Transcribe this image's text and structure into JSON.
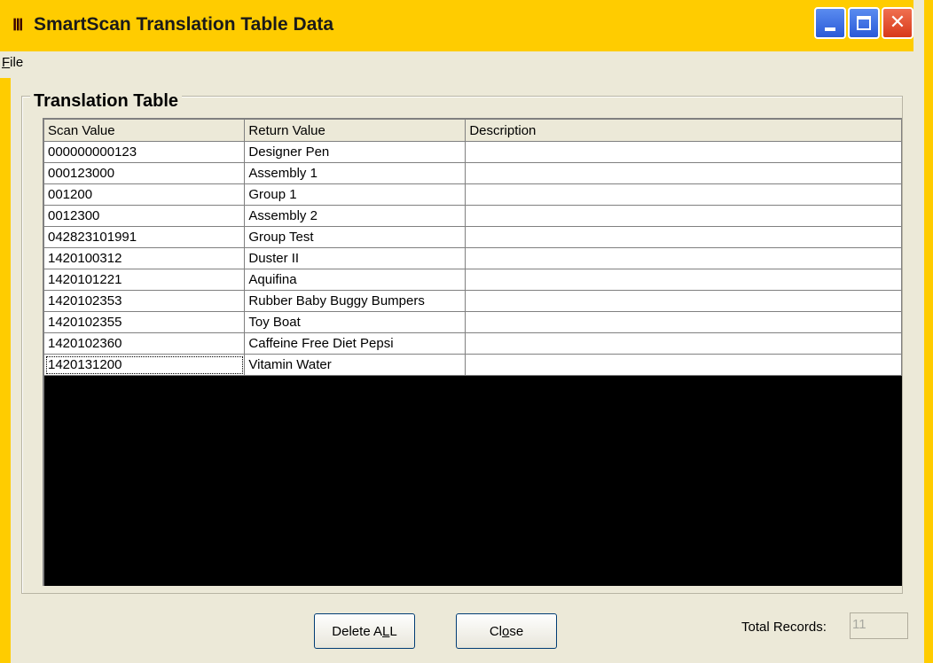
{
  "window": {
    "title": "SmartScan Translation Table Data",
    "icon": "barcode-icon",
    "icon_glyph": "Ⅲ",
    "controls": {
      "minimize": "minimize-icon",
      "maximize": "maximize-icon",
      "close": "close-icon",
      "close_glyph": "✕"
    }
  },
  "menu": {
    "file": "File"
  },
  "group": {
    "legend": "Translation Table"
  },
  "table": {
    "columns": [
      "Scan Value",
      "Return Value",
      "Description"
    ],
    "rows": [
      [
        "000000000123",
        "Designer Pen",
        ""
      ],
      [
        "000123000",
        "Assembly 1",
        ""
      ],
      [
        "001200",
        "Group 1",
        ""
      ],
      [
        "0012300",
        "Assembly 2",
        ""
      ],
      [
        "042823101991",
        "Group Test",
        ""
      ],
      [
        "1420100312",
        "Duster II",
        ""
      ],
      [
        "1420101221",
        "Aquifina",
        ""
      ],
      [
        "1420102353",
        "Rubber Baby Buggy Bumpers",
        ""
      ],
      [
        "1420102355",
        "Toy Boat",
        ""
      ],
      [
        "1420102360",
        "Caffeine Free Diet Pepsi",
        ""
      ],
      [
        "1420131200",
        "Vitamin Water",
        ""
      ]
    ]
  },
  "buttons": {
    "delete_all": "Delete ALL",
    "close": "Close"
  },
  "footer": {
    "total_label": "Total Records:",
    "total_value": "11"
  },
  "colors": {
    "desktop": "#FFCC00",
    "window_bg": "#ECE9D8",
    "grid_bg": "#000000"
  }
}
